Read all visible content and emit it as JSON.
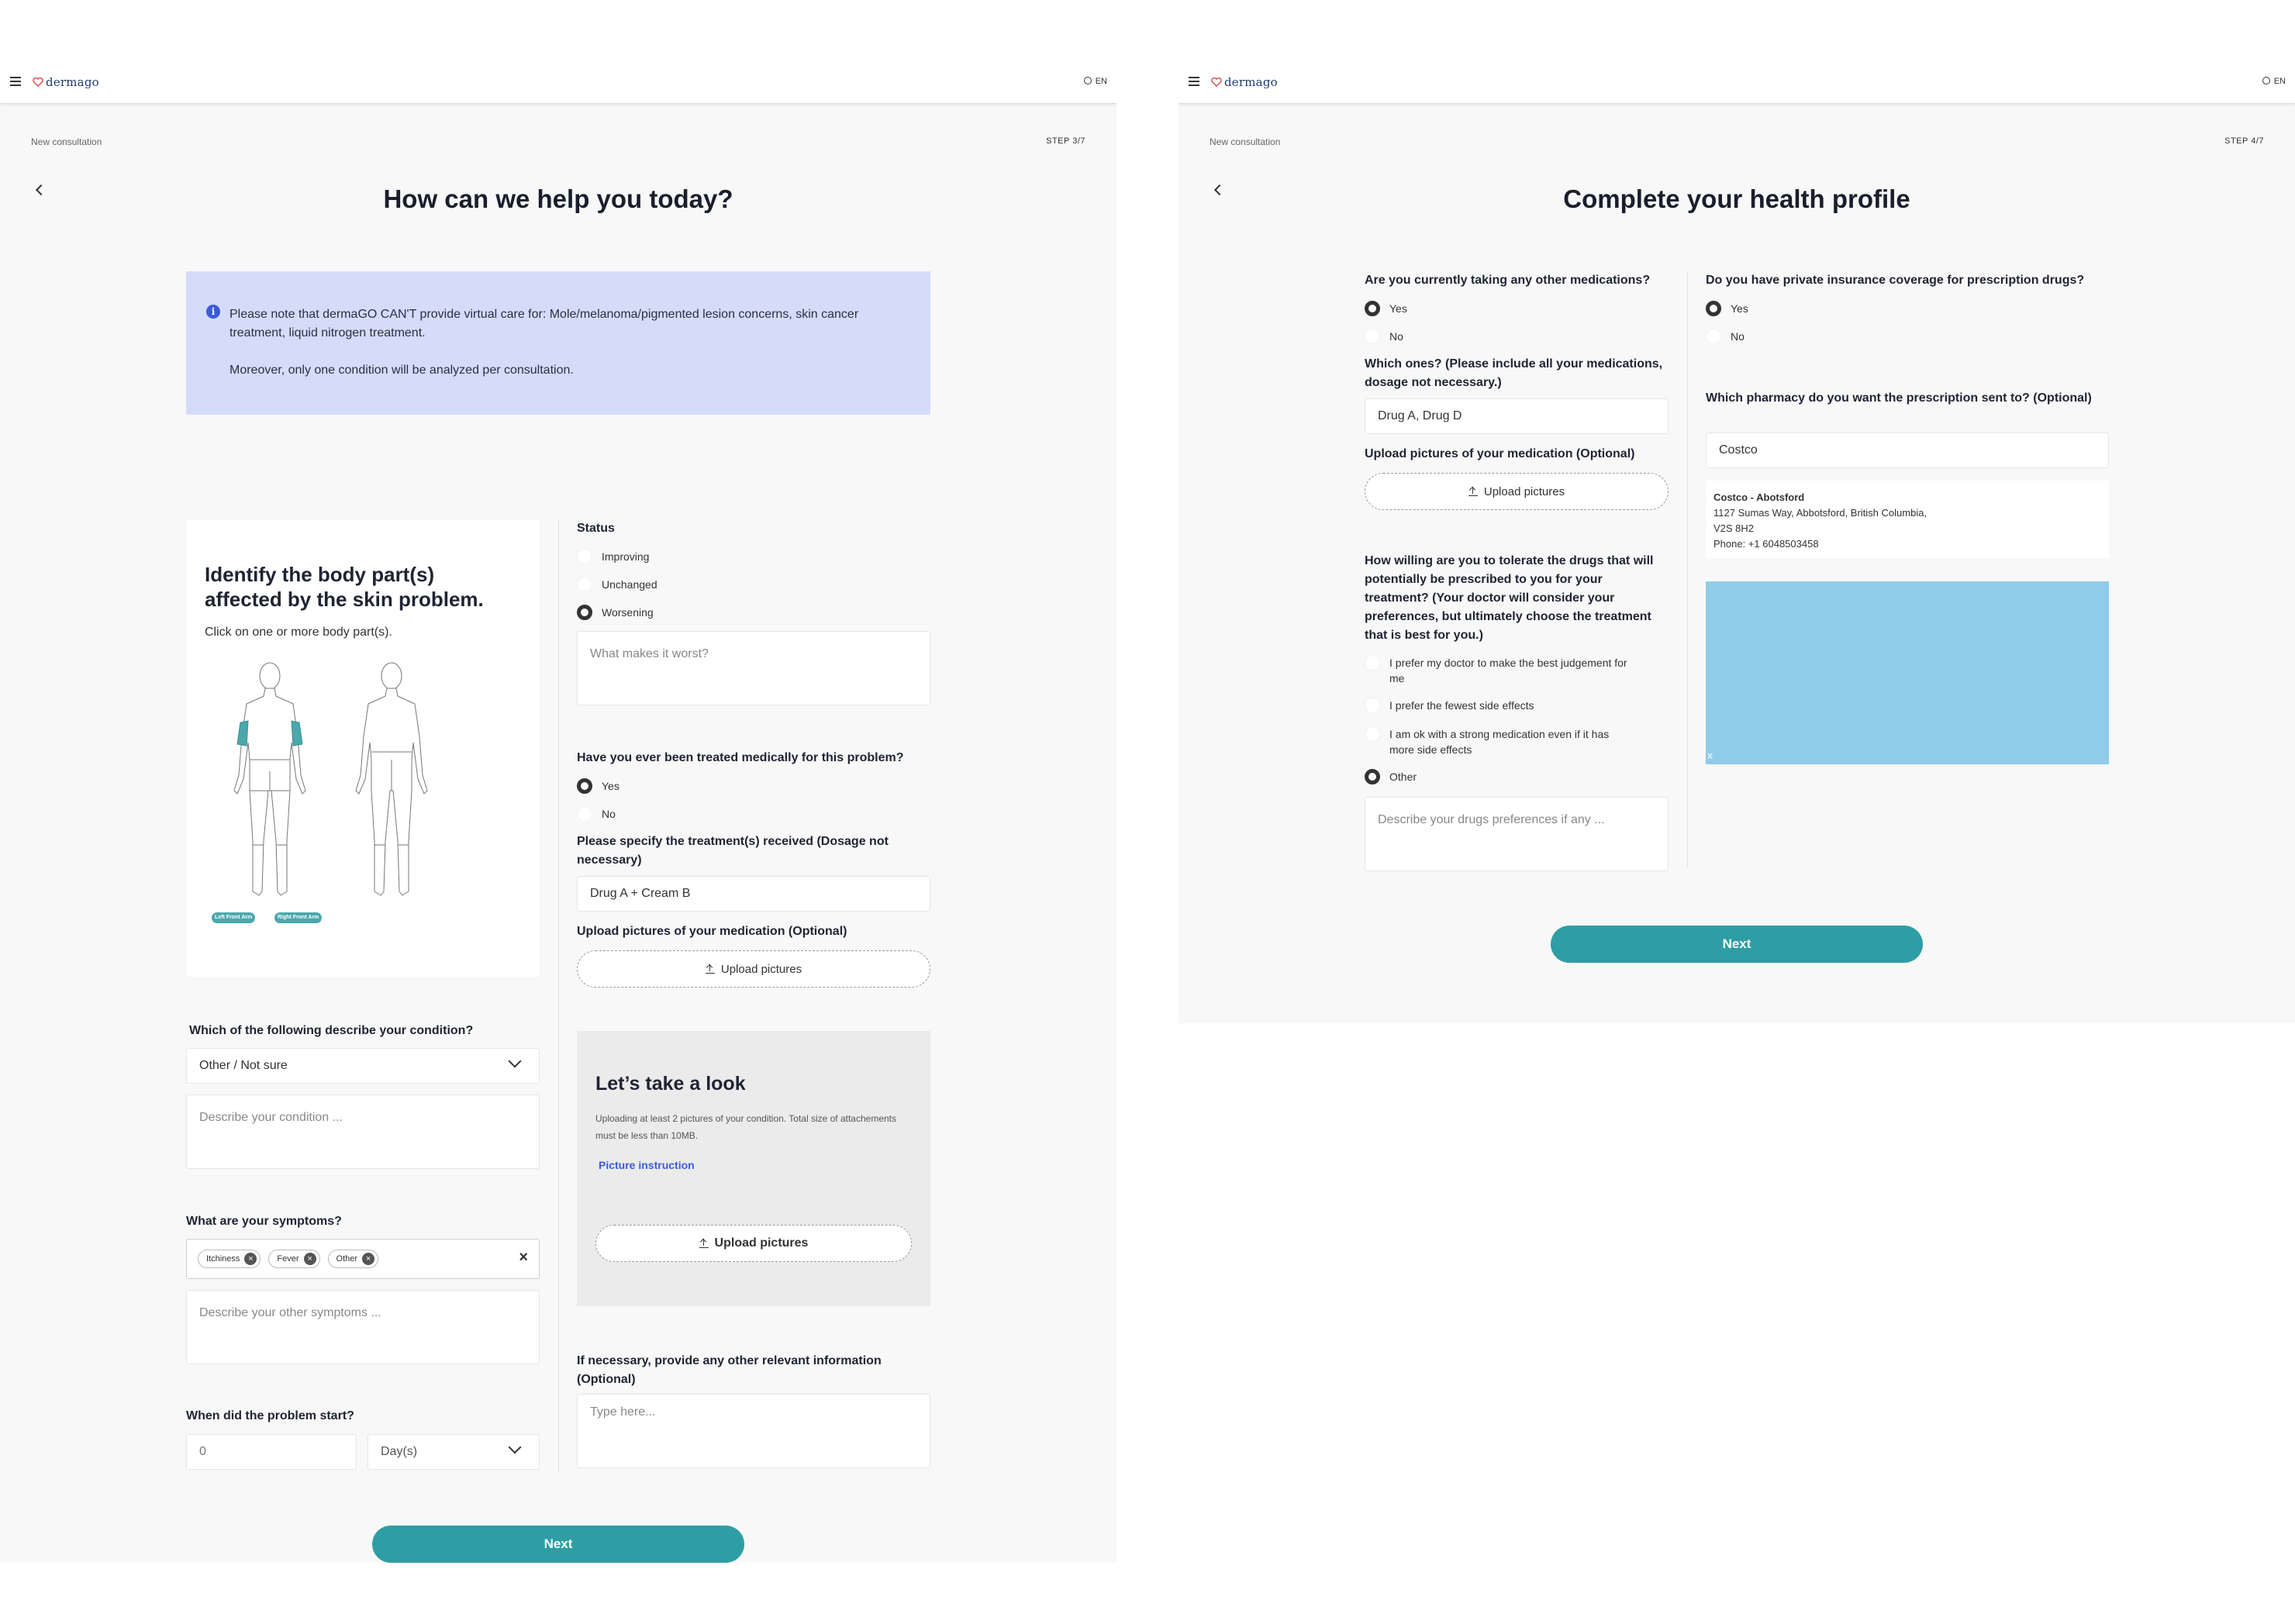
{
  "brand": "dermago",
  "language": "EN",
  "colors": {
    "accent": "#2e9ea4",
    "notice_bg": "#d5dcfa",
    "link": "#3b5bdb",
    "map": "#8ecce9"
  },
  "screen_a": {
    "breadcrumb": "New consultation",
    "step": "STEP 3/7",
    "title": "How can we help you today?",
    "notice": {
      "line1": "Please note that dermaGO CAN'T provide virtual care for: Mole/melanoma/pigmented lesion concerns, skin cancer treatment, liquid nitrogen treatment.",
      "line2": "Moreover, only one condition will be analyzed per consultation."
    },
    "body": {
      "title_line1": "Identify the body part(s)",
      "title_line2": "affected by the skin problem.",
      "subtitle": "Click on one or more body part(s).",
      "selected_tags": [
        "Left Front Arm",
        "Right Front Arm"
      ]
    },
    "condition": {
      "label": "Which of the following describe your condition?",
      "value": "Other / Not sure",
      "placeholder": "Describe your condition ..."
    },
    "symptoms": {
      "label": "What are your symptoms?",
      "chips": [
        "Itchiness",
        "Fever",
        "Other"
      ],
      "placeholder": "Describe your other symptoms ..."
    },
    "start": {
      "label": "When did the problem start?",
      "value": "0",
      "unit": "Day(s)"
    },
    "status": {
      "label": "Status",
      "options": [
        "Improving",
        "Unchanged",
        "Worsening"
      ],
      "selected": "Worsening",
      "placeholder": "What makes it worst?"
    },
    "treated": {
      "label": "Have you ever been treated medically for this problem?",
      "options": [
        "Yes",
        "No"
      ],
      "selected": "Yes",
      "specify_label": "Please specify the treatment(s) received (Dosage not necessary)",
      "specify_value": "Drug A + Cream B",
      "upload_label": "Upload pictures of your medication (Optional)",
      "upload_button": "Upload pictures"
    },
    "look": {
      "title": "Let’s take a look",
      "text": "Uploading at least 2 pictures of your condition. Total size of attachements must be less than 10MB.",
      "link": "Picture instruction",
      "upload_button": "Upload pictures"
    },
    "other_info": {
      "label": "If necessary, provide any other relevant information (Optional)",
      "placeholder": "Type here..."
    },
    "next": "Next"
  },
  "screen_b": {
    "breadcrumb": "New consultation",
    "step": "STEP 4/7",
    "title": "Complete your health profile",
    "medications": {
      "label": "Are you currently taking any other medications?",
      "options": [
        "Yes",
        "No"
      ],
      "selected": "Yes",
      "which_label": "Which ones? (Please include all your medications, dosage not necessary.)",
      "which_value": "Drug A, Drug D",
      "upload_label": "Upload pictures of your medication (Optional)",
      "upload_button": "Upload pictures"
    },
    "tolerance": {
      "label": "How willing are you to tolerate the drugs that will potentially be prescribed to you for your treatment? (Your doctor will consider your preferences, but ultimately choose the treatment that is best for you.)",
      "options": [
        "I prefer my doctor to make the best judgement for me",
        "I prefer the fewest side effects",
        "I am ok with a strong medication even if it has more side effects",
        "Other"
      ],
      "selected": "Other",
      "placeholder": "Describe your drugs preferences if any ..."
    },
    "insurance": {
      "label": "Do you have private insurance coverage for prescription drugs?",
      "options": [
        "Yes",
        "No"
      ],
      "selected": "Yes"
    },
    "pharmacy": {
      "label": "Which pharmacy do you want the prescription sent to? (Optional)",
      "value": "Costco",
      "result_name": "Costco - Abotsford",
      "result_address1": "1127 Sumas Way, Abbotsford, British Columbia,",
      "result_address2": "V2S 8H2",
      "result_phone": "Phone: +1 6048503458",
      "map_mark": "x"
    },
    "next": "Next"
  }
}
